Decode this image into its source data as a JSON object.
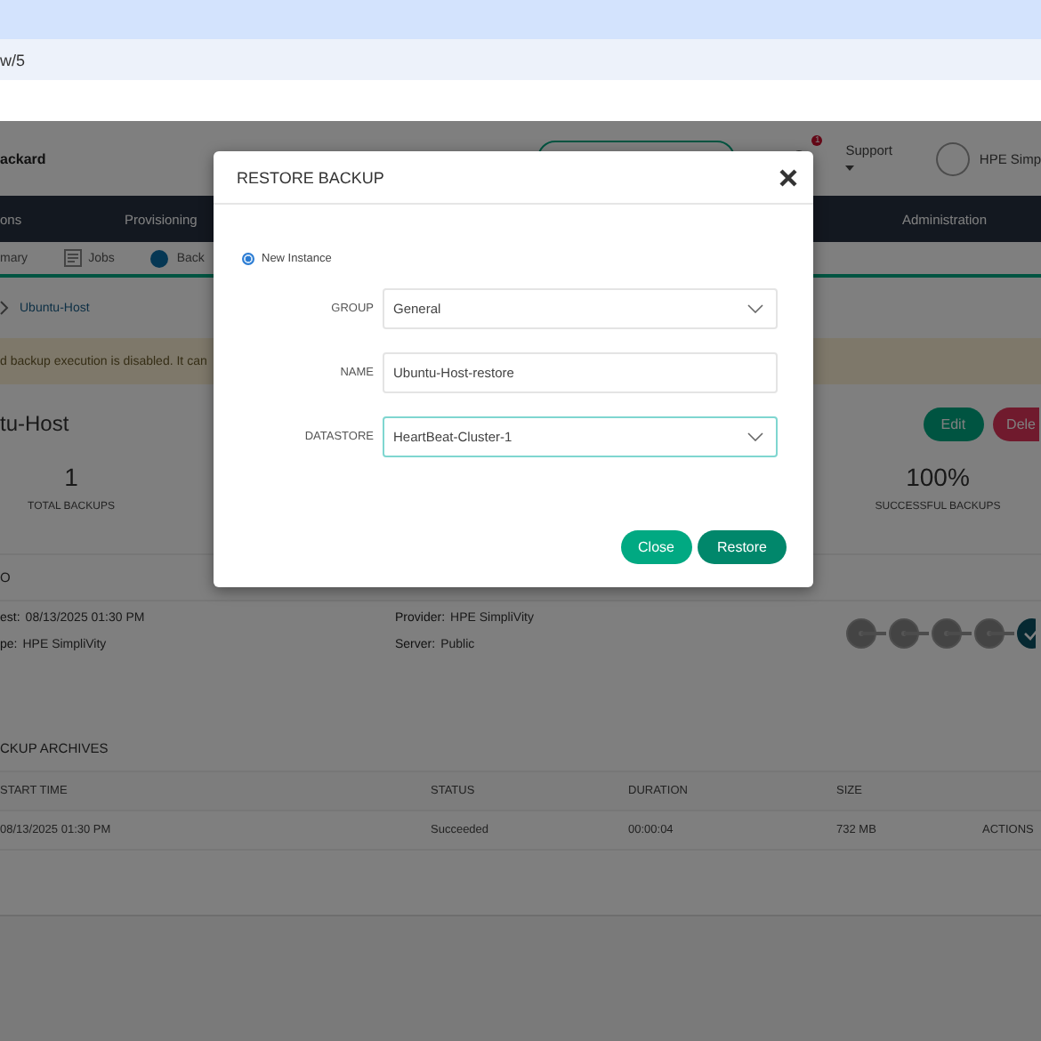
{
  "browser": {
    "address": "w/5"
  },
  "header": {
    "brand": "ackard",
    "notification_count": "1",
    "support": "Support",
    "user": "HPE Simp"
  },
  "nav": [
    "ons",
    "Provisioning",
    "Administration"
  ],
  "subnav": [
    {
      "label": "mary",
      "kind": "text"
    },
    {
      "label": "Jobs",
      "kind": "jobs"
    },
    {
      "label": "Back",
      "kind": "backup"
    }
  ],
  "breadcrumb": [
    "Ubuntu-Host"
  ],
  "alert": "d backup execution is disabled. It can",
  "title": "tu-Host",
  "actions": [
    {
      "label": "Edit",
      "kind": "edit"
    },
    {
      "label": "Dele",
      "kind": "delete"
    }
  ],
  "stats": [
    {
      "value": "1",
      "label": "TOTAL BACKUPS"
    },
    {
      "value": "100%",
      "label": "SUCCESSFUL BACKUPS"
    }
  ],
  "info": {
    "heading": "O",
    "fields": [
      {
        "label": "est:",
        "value": "08/13/2025 01:30 PM"
      },
      {
        "label": "Provider:",
        "value": "HPE SimpliVity"
      },
      {
        "label": "pe:",
        "value": "HPE SimpliVity"
      },
      {
        "label": "Server:",
        "value": "Public"
      }
    ],
    "steps": [
      {
        "done": false
      },
      {
        "done": false
      },
      {
        "done": false
      },
      {
        "done": false
      },
      {
        "done": true
      }
    ]
  },
  "archives": {
    "heading": "CKUP ARCHIVES",
    "columns": [
      "START TIME",
      "STATUS",
      "DURATION",
      "SIZE"
    ],
    "rows": [
      [
        "08/13/2025 01:30 PM",
        "Succeeded",
        "00:00:04",
        "732 MB",
        "ACTIONS"
      ]
    ]
  },
  "modal": {
    "title": "RESTORE BACKUP",
    "option": {
      "label": "New Instance",
      "selected": true
    },
    "fields": [
      {
        "label": "GROUP",
        "kind": "select",
        "value": "General",
        "focused": false
      },
      {
        "label": "NAME",
        "kind": "text",
        "value": "Ubuntu-Host-restore",
        "focused": false
      },
      {
        "label": "DATASTORE",
        "kind": "select",
        "value": "HeartBeat-Cluster-1",
        "focused": true
      }
    ],
    "buttons": [
      {
        "label": "Close",
        "kind": "secondary"
      },
      {
        "label": "Restore",
        "kind": "primary"
      }
    ]
  }
}
